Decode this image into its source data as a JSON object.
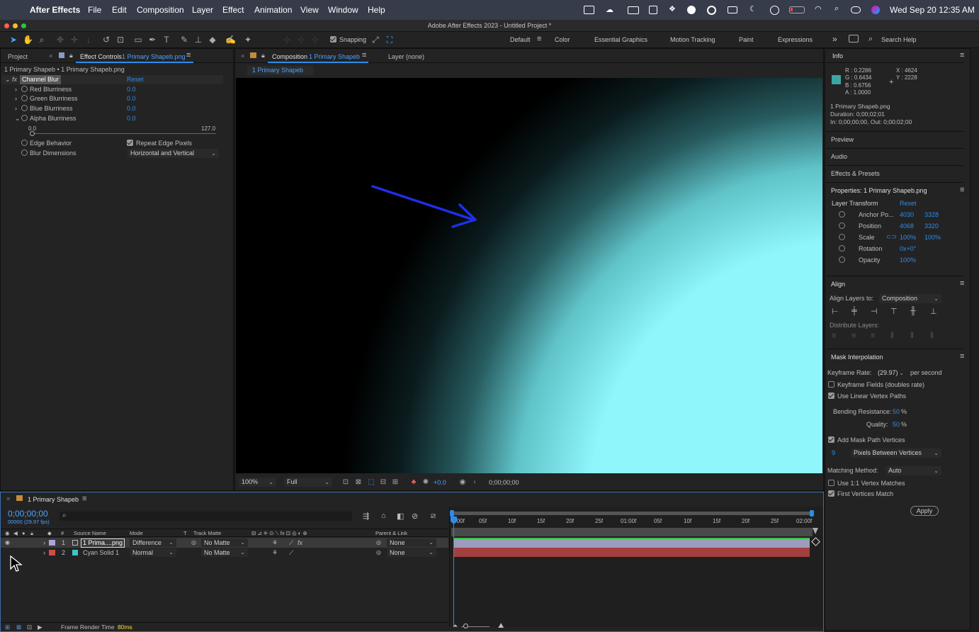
{
  "menubar": {
    "app_name": "After Effects",
    "items": [
      "File",
      "Edit",
      "Composition",
      "Layer",
      "Effect",
      "Animation",
      "View",
      "Window",
      "Help"
    ],
    "clock": "Wed Sep 20  12:35 AM"
  },
  "window": {
    "title": "Adobe After Effects 2023 - Untitled Project *"
  },
  "toolbar": {
    "snapping_label": "Snapping",
    "workspaces": [
      "Default",
      "Color",
      "Essential Graphics",
      "Motion Tracking",
      "Paint",
      "Expressions"
    ],
    "active_workspace": "Default",
    "search_placeholder": "Search Help"
  },
  "left_panel": {
    "tab_project": "Project",
    "tab_effect_controls": "Effect Controls",
    "tab_effect_controls_layer": "1 Primary Shapeb.png",
    "breadcrumb": "1 Primary Shapeb • 1 Primary Shapeb.png",
    "effect_name": "Channel Blur",
    "reset_label": "Reset",
    "params": [
      {
        "label": "Red Blurriness",
        "value": "0.0"
      },
      {
        "label": "Green Blurriness",
        "value": "0.0"
      },
      {
        "label": "Blue Blurriness",
        "value": "0.0"
      },
      {
        "label": "Alpha Blurriness",
        "value": "0.0"
      }
    ],
    "slider_min": "0.0",
    "slider_max": "127.0",
    "edge_behavior_label": "Edge Behavior",
    "repeat_edge_label": "Repeat Edge Pixels",
    "blur_dimensions_label": "Blur Dimensions",
    "blur_dimensions_value": "Horizontal and Vertical"
  },
  "composition_panel": {
    "tab_label": "Composition",
    "tab_comp_name": "1 Primary Shapeb",
    "layer_tab": "Layer (none)",
    "comp_subtab": "1 Primary Shapeb",
    "zoom": "100%",
    "resolution": "Full",
    "exposure": "+0.0",
    "timecode": "0;00;00;00"
  },
  "right_panel": {
    "info_title": "Info",
    "info_r": "R : 0.2286",
    "info_g": "G : 0.6434",
    "info_b": "B : 0.6756",
    "info_a": "A : 1.0000",
    "info_x": "X : 4624",
    "info_y": "Y : 2228",
    "info_color": "#3aa6a4",
    "file_name": "1 Primary Shapeb.png",
    "duration": "Duration: 0;00;02;01",
    "in_out": "In: 0;00;00;00, Out: 0;00;02;00",
    "preview": "Preview",
    "audio": "Audio",
    "effects_presets": "Effects & Presets",
    "properties_title": "Properties: 1 Primary Shapeb.png",
    "layer_transform": "Layer Transform",
    "reset": "Reset",
    "anchor_label": "Anchor Po...",
    "anchor_x": "4030",
    "anchor_y": "3328",
    "position_label": "Position",
    "position_x": "4068",
    "position_y": "3320",
    "scale_label": "Scale",
    "scale_x": "100%",
    "scale_y": "100%",
    "rotation_label": "Rotation",
    "rotation_value": "0x+0°",
    "opacity_label": "Opacity",
    "opacity_value": "100%",
    "align_title": "Align",
    "align_layers_to_label": "Align Layers to:",
    "align_layers_to_value": "Composition",
    "distribute_layers": "Distribute Layers:",
    "mask_title": "Mask Interpolation",
    "keyframe_rate_label": "Keyframe Rate:",
    "keyframe_rate_value": "(29.97)",
    "per_second": "per second",
    "keyframe_fields": "Keyframe Fields (doubles rate)",
    "linear_vertex": "Use Linear Vertex Paths",
    "bending_label": "Bending Resistance:",
    "bending_value": "50",
    "quality_label": "Quality:",
    "quality_value": "50",
    "percent": "%",
    "add_mask_vertices": "Add Mask Path Vertices",
    "vertices_count": "9",
    "pixels_between": "Pixels Between Vertices",
    "matching_label": "Matching Method:",
    "matching_value": "Auto",
    "use_1to1": "Use 1:1 Vertex Matches",
    "first_vertices": "First Vertices Match",
    "apply": "Apply"
  },
  "timeline": {
    "tab_label": "1 Primary Shapeb",
    "timecode": "0;00;00;00",
    "frame_info": "00000 (29.97 fps)",
    "col_source": "Source Name",
    "col_mode": "Mode",
    "col_t": "T",
    "col_track": "Track Matte",
    "col_parent": "Parent & Link",
    "ruler": [
      "0:00f",
      "05f",
      "10f",
      "15f",
      "20f",
      "25f",
      "01:00f",
      "05f",
      "10f",
      "15f",
      "20f",
      "25f",
      "02:00f"
    ],
    "layers": [
      {
        "num": "1",
        "name": "1 Prima....png",
        "mode": "Difference",
        "matte": "No Matte",
        "parent": "None",
        "color": "#a9a6d8"
      },
      {
        "num": "2",
        "name": "Cyan Solid 1",
        "mode": "Normal",
        "matte": "No Matte",
        "parent": "None",
        "color": "#d24a4a"
      }
    ],
    "render_label": "Frame Render Time",
    "render_value": "80ms"
  }
}
